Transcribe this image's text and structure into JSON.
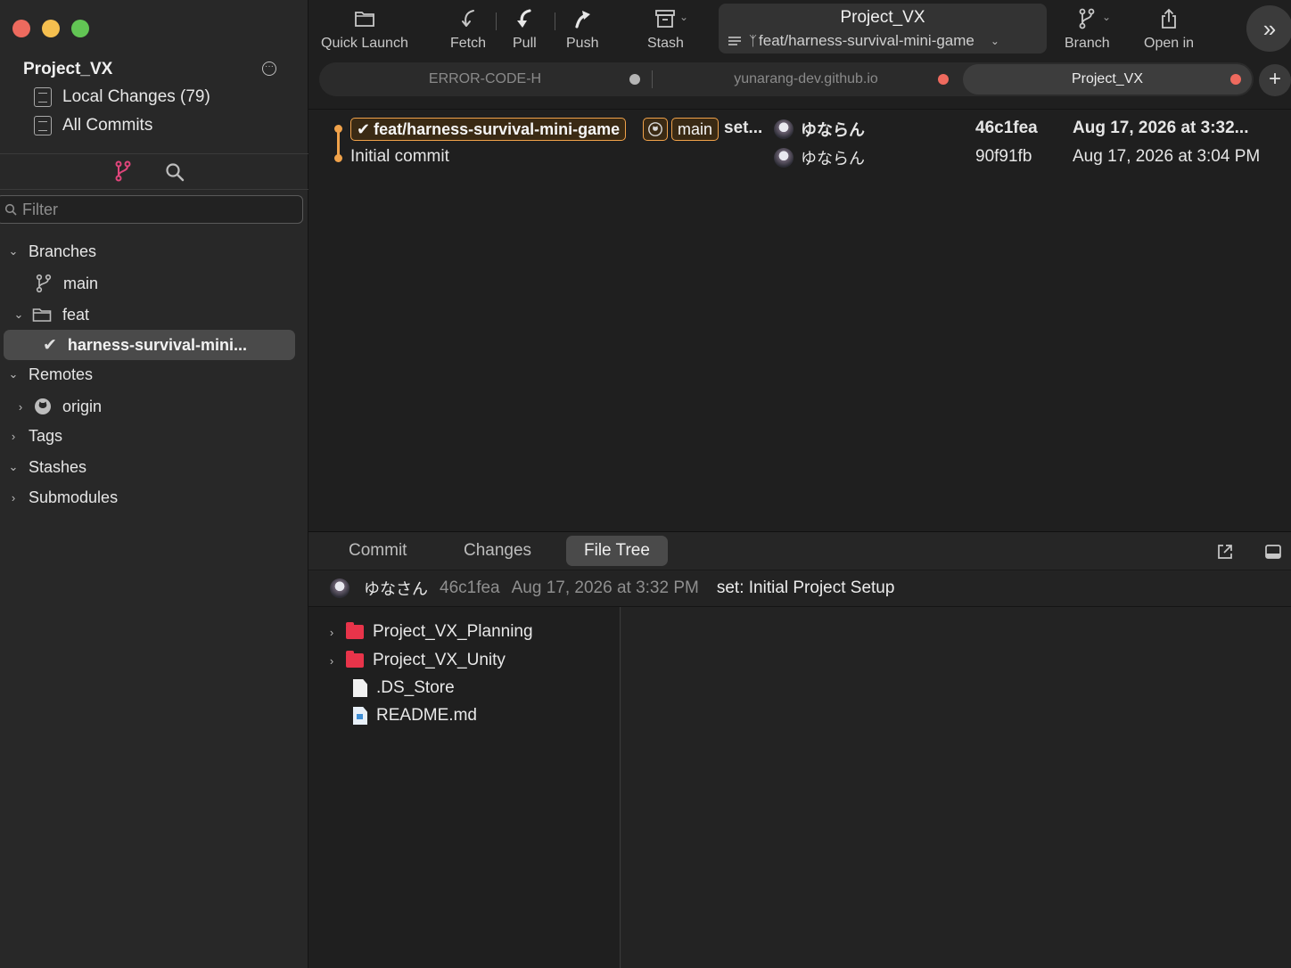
{
  "sidebar": {
    "repo_name": "Project_VX",
    "local_changes": "Local Changes (79)",
    "all_commits": "All Commits",
    "filter_placeholder": "Filter",
    "branches_label": "Branches",
    "branch_main": "main",
    "folder_feat": "feat",
    "branch_current": "harness-survival-mini...",
    "remotes_label": "Remotes",
    "remote_origin": "origin",
    "tags_label": "Tags",
    "stashes_label": "Stashes",
    "submodules_label": "Submodules"
  },
  "toolbar": {
    "quick_launch": "Quick Launch",
    "fetch": "Fetch",
    "pull": "Pull",
    "push": "Push",
    "stash": "Stash",
    "repo_title": "Project_VX",
    "repo_branch": "feat/harness-survival-mini-game",
    "branch": "Branch",
    "open_in": "Open in"
  },
  "tabs": [
    {
      "label": "ERROR-CODE-H",
      "dot_color": "#b5b5b5"
    },
    {
      "label": "yunarang-dev.github.io",
      "dot_color": "#ef6a5e"
    },
    {
      "label": "Project_VX",
      "dot_color": "#ef6a5e"
    }
  ],
  "commits": [
    {
      "branch_ref": "feat/harness-survival-mini-game",
      "main_ref": "main",
      "message": "set...",
      "author": "ゆならん",
      "hash": "46c1fea",
      "date": "Aug 17, 2026 at 3:32..."
    },
    {
      "message": "Initial commit",
      "author": "ゆならん",
      "hash": "90f91fb",
      "date": "Aug 17, 2026 at 3:04 PM"
    }
  ],
  "panel": {
    "tab_commit": "Commit",
    "tab_changes": "Changes",
    "tab_file_tree": "File Tree",
    "author": "ゆなさん",
    "hash": "46c1fea",
    "date": "Aug 17, 2026 at 3:32 PM",
    "message": "set: Initial Project Setup"
  },
  "files": [
    {
      "name": "Project_VX_Planning",
      "type": "folder"
    },
    {
      "name": "Project_VX_Unity",
      "type": "folder"
    },
    {
      "name": ".DS_Store",
      "type": "file"
    },
    {
      "name": "README.md",
      "type": "markdown"
    }
  ],
  "colors": {
    "accent": "#f0a24a",
    "folder": "#e8344a",
    "branch_icon": "#e0457b"
  }
}
